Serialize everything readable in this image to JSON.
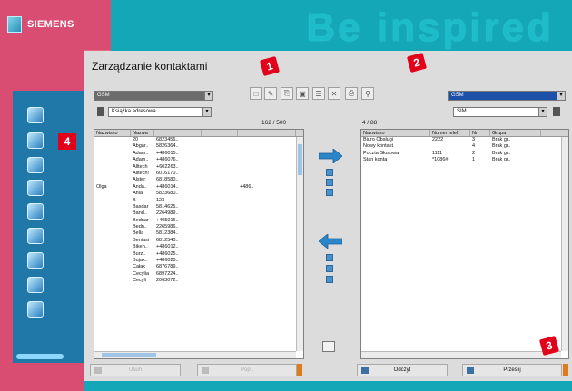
{
  "brand": "SIEMENS",
  "slogan": "Be inspired",
  "window_title": "Zarządzanie kontaktami",
  "left_panel": {
    "source_select": "GSM",
    "book_select": "Książka adresowa",
    "counter": "162 / 500",
    "columns": [
      "Nazwisko",
      "Nazwa",
      "",
      "",
      ""
    ],
    "rows": [
      [
        "",
        "20",
        "6823456..",
        "",
        ""
      ],
      [
        "",
        "Abgar..",
        "5826364..",
        "",
        ""
      ],
      [
        "",
        "Adam..",
        "+486015..",
        "",
        ""
      ],
      [
        "",
        "Adam..",
        "+486076..",
        "",
        ""
      ],
      [
        "",
        "Alltech",
        "+602263..",
        "",
        ""
      ],
      [
        "",
        "Alltech!",
        "6016170..",
        "",
        ""
      ],
      [
        "",
        "Alster",
        "6818580..",
        "",
        ""
      ],
      [
        "Olga",
        "Anda..",
        "+486014..",
        "",
        "+486.."
      ],
      [
        "",
        "Ania",
        "5823680..",
        "",
        ""
      ],
      [
        "",
        "B",
        "123",
        "",
        ""
      ],
      [
        "",
        "Basdar",
        "5814625..",
        "",
        ""
      ],
      [
        "",
        "Band..",
        "2264989..",
        "",
        ""
      ],
      [
        "",
        "Bednar",
        "+405016..",
        "",
        ""
      ],
      [
        "",
        "Bedn..",
        "2265986..",
        "",
        ""
      ],
      [
        "",
        "Bella",
        "5812384..",
        "",
        ""
      ],
      [
        "",
        "Beniasi",
        "6812540..",
        "",
        ""
      ],
      [
        "",
        "Biken..",
        "+486012..",
        "",
        ""
      ],
      [
        "",
        "Burz..",
        "+486025..",
        "",
        ""
      ],
      [
        "",
        "Bujak..",
        "+486025..",
        "",
        ""
      ],
      [
        "",
        "Całak",
        "6876789..",
        "",
        ""
      ],
      [
        "",
        "Cecylia",
        "6897224..",
        "",
        ""
      ],
      [
        "",
        "Cecyli",
        "2063072..",
        "",
        ""
      ]
    ],
    "btn_left": "Usuń",
    "btn_right": "Popr."
  },
  "right_panel": {
    "source_select": "GSM",
    "book_select": "SIM",
    "counter": "4 / 88",
    "columns": [
      "Nazwisko",
      "Numer telef.",
      "Nr",
      "Grupa"
    ],
    "rows": [
      [
        "Biuro Obsługi",
        "2222",
        "3",
        "Brak gr.."
      ],
      [
        "Nowy kontakt",
        "",
        "4",
        "Brak gr.."
      ],
      [
        "Poczta Słosowa",
        "1111",
        "2",
        "Brak gr.."
      ],
      [
        "Stan konta",
        "*1086#",
        "1",
        "Brak gr.."
      ]
    ],
    "btn_left": "Odczyt",
    "btn_right": "Prześlij"
  },
  "callouts": [
    "1",
    "2",
    "3",
    "4"
  ],
  "colors": {
    "pink": "#d94d73",
    "teal": "#14a7b7",
    "callout_red": "#e2001a"
  }
}
